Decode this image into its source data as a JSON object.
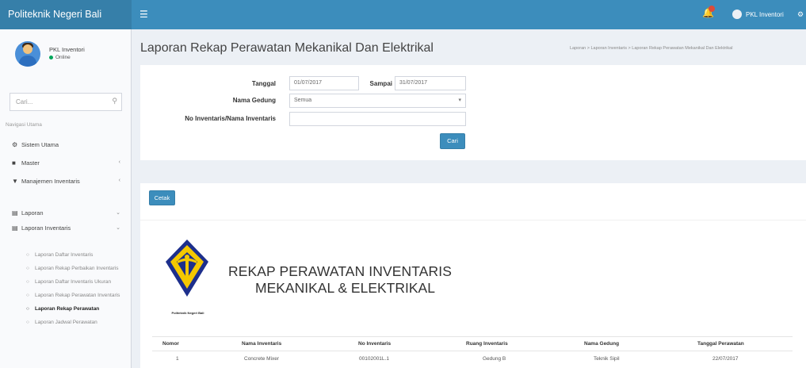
{
  "header": {
    "brand": "Politeknik Negeri Bali",
    "menu_icon": "hamburger-icon",
    "notification_icon": "bell-icon",
    "user_label": "PKL Inventori",
    "more_icon": "gear-icon"
  },
  "sidebar": {
    "user_name": "PKL Inventori",
    "user_status": "Online",
    "search_placeholder": "Cari...",
    "section_header": "Navigasi Utama",
    "items": [
      {
        "label": "Sistem Utama",
        "icon": "settings-icon"
      },
      {
        "label": "Master",
        "icon": "database-icon"
      },
      {
        "label": "Manajemen Inventaris",
        "icon": "cart-icon"
      },
      {
        "label": "Laporan",
        "icon": "file-icon"
      },
      {
        "label": "Laporan Inventaris",
        "icon": "file-icon"
      }
    ],
    "sub_items": [
      "Laporan Daftar Inventaris",
      "Laporan Rekap Perbaikan Inventaris",
      "Laporan Daftar Inventaris Ukuran",
      "Laporan Rekap Perawatan Inventaris",
      "Laporan Rekap Perawatan",
      "Laporan Jadwal Perawatan"
    ]
  },
  "page": {
    "title": "Laporan Rekap Perawatan Mekanikal Dan Elektrikal",
    "breadcrumb": "Laporan > Laporan Inventaris > Laporan Rekap Perawatan Mekanikal Dan Elektrikal"
  },
  "filter": {
    "tanggal_label": "Tanggal",
    "tanggal_value": "01/07/2017",
    "sampai_label": "Sampai",
    "sampai_value": "31/07/2017",
    "gedung_label": "Nama Gedung",
    "gedung_value": "Semua",
    "inventaris_label": "No Inventaris/Nama Inventaris",
    "inventaris_value": "",
    "cari_button": "Cari"
  },
  "report": {
    "cetak_button": "Cetak",
    "logo_caption": "Politeknik Negeri Bali",
    "title_line1": "REKAP PERAWATAN INVENTARIS",
    "title_line2": "MEKANIKAL & ELEKTRIKAL",
    "columns": [
      "Nomor",
      "Nama Inventaris",
      "No Inventaris",
      "Ruang Inventaris",
      "Nama Gedung",
      "Tanggal Perawatan"
    ],
    "rows": [
      [
        "1",
        "Concrete Mixer",
        "00102001L.1",
        "Gedung B",
        "Teknik Sipil",
        "22/07/2017"
      ]
    ]
  },
  "colors": {
    "header": "#3c8dbc",
    "brand_bg": "#367fa9",
    "status_online": "#00a65a",
    "logo_blue": "#1d2f8c",
    "logo_yellow": "#f5c800"
  }
}
